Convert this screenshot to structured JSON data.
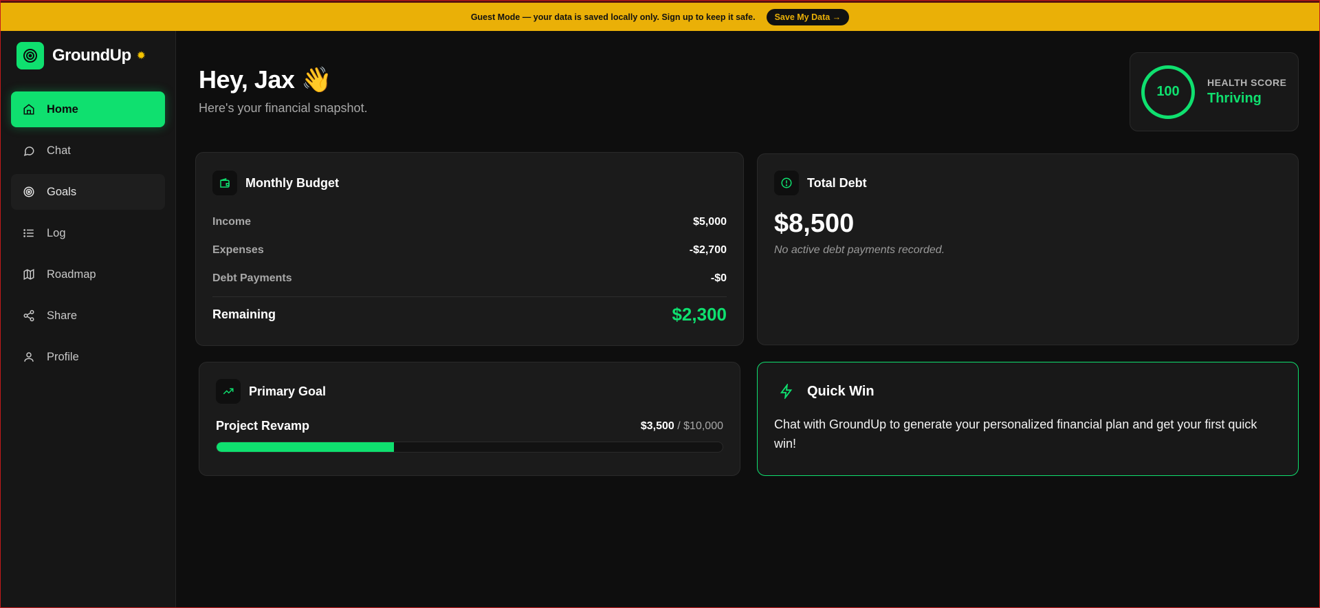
{
  "banner": {
    "text": "Guest Mode — your data is saved locally only. Sign up to keep it safe.",
    "button": "Save My Data →"
  },
  "brand": {
    "name": "GroundUp"
  },
  "nav": {
    "items": [
      {
        "label": "Home",
        "icon": "home-icon"
      },
      {
        "label": "Chat",
        "icon": "chat-icon"
      },
      {
        "label": "Goals",
        "icon": "target-icon"
      },
      {
        "label": "Log",
        "icon": "list-icon"
      },
      {
        "label": "Roadmap",
        "icon": "map-icon"
      },
      {
        "label": "Share",
        "icon": "share-icon"
      },
      {
        "label": "Profile",
        "icon": "user-icon"
      }
    ]
  },
  "header": {
    "greeting": "Hey, Jax 👋",
    "subtitle": "Here's your financial snapshot."
  },
  "health": {
    "score": "100",
    "label": "HEALTH SCORE",
    "status": "Thriving"
  },
  "budget": {
    "title": "Monthly Budget",
    "rows": [
      {
        "label": "Income",
        "value": "$5,000"
      },
      {
        "label": "Expenses",
        "value": "-$2,700"
      },
      {
        "label": "Debt Payments",
        "value": "-$0"
      }
    ],
    "remaining_label": "Remaining",
    "remaining_value": "$2,300"
  },
  "debt": {
    "title": "Total Debt",
    "amount": "$8,500",
    "note": "No active debt payments recorded."
  },
  "goal": {
    "title": "Primary Goal",
    "name": "Project Revamp",
    "current": "$3,500",
    "separator": " / ",
    "target": "$10,000",
    "progress": 0.35
  },
  "quick_win": {
    "title": "Quick Win",
    "text": "Chat with GroundUp to generate your personalized financial plan and get your first quick win!"
  },
  "colors": {
    "accent": "#0fe06f",
    "banner": "#eab007",
    "background": "#0e0e0e"
  }
}
